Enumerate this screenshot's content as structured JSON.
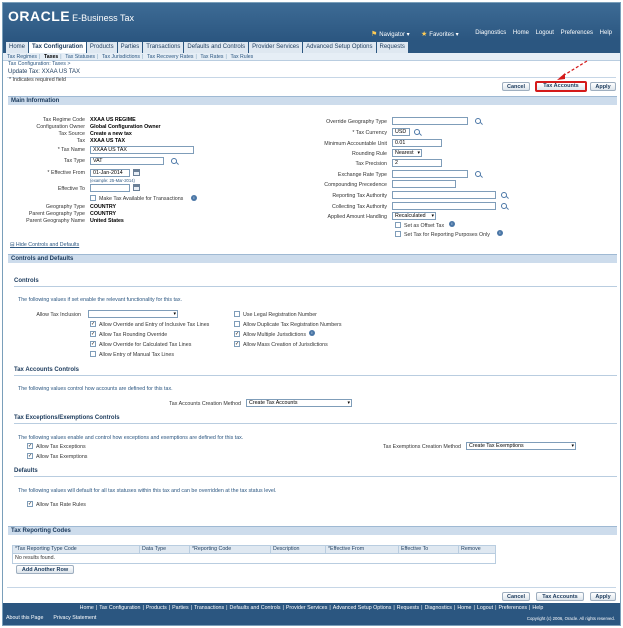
{
  "header": {
    "logo": "ORACLE",
    "product": "E-Business Tax",
    "navigator": "Navigator",
    "favorites": "Favorites",
    "global_links": [
      "Diagnostics",
      "Home",
      "Logout",
      "Preferences",
      "Help"
    ]
  },
  "tabs": [
    "Home",
    "Tax Configuration",
    "Products",
    "Parties",
    "Transactions",
    "Defaults and Controls",
    "Provider Services",
    "Advanced Setup Options",
    "Requests"
  ],
  "subtabs": [
    "Tax Regimes",
    "Taxes",
    "Tax Statuses",
    "Tax Jurisdictions",
    "Tax Recovery Rates",
    "Tax Rates",
    "Tax Rules"
  ],
  "page": {
    "breadcrumb": "Tax Configuration: Taxes >",
    "title": "Update Tax: XXAA US TAX",
    "required_note": "* Indicates required field",
    "buttons": {
      "cancel": "Cancel",
      "tax_accounts": "Tax Accounts",
      "apply": "Apply"
    }
  },
  "main_info": {
    "heading": "Main Information",
    "left": {
      "tax_regime_code_label": "Tax Regime Code",
      "tax_regime_code": "XXAA US REGIME",
      "config_owner_label": "Configuration Owner",
      "config_owner": "Global Configuration Owner",
      "tax_source_label": "Tax Source",
      "tax_source": "Create a new tax",
      "tax_label": "Tax",
      "tax": "XXAA US TAX",
      "tax_name_label": "* Tax Name",
      "tax_name": "XXAA US TAX",
      "tax_type_label": "Tax Type",
      "tax_type": "VAT",
      "effective_from_label": "* Effective From",
      "effective_from": "01-Jan-2014",
      "effective_from_hint": "(example: 25-Mar-2014)",
      "effective_to_label": "Effective To",
      "make_available_label": "Make Tax Available for Transactions",
      "geography_type_label": "Geography Type",
      "geography_type": "COUNTRY",
      "parent_geo_type_label": "Parent Geography Type",
      "parent_geo_type": "COUNTRY",
      "parent_geo_name_label": "Parent Geography Name",
      "parent_geo_name": "United States"
    },
    "right": {
      "override_geo_type_label": "Override Geography Type",
      "tax_currency_label": "* Tax Currency",
      "tax_currency": "USD",
      "min_acct_unit_label": "Minimum Accountable Unit",
      "min_acct_unit": "0.01",
      "rounding_rule_label": "Rounding Rule",
      "rounding_rule": "Nearest",
      "tax_precision_label": "Tax Precision",
      "tax_precision": "2",
      "exchange_rate_type_label": "Exchange Rate Type",
      "compounding_precedence_label": "Compounding Precedence",
      "reporting_tax_authority_label": "Reporting Tax Authority",
      "collecting_tax_authority_label": "Collecting Tax Authority",
      "applied_amount_handling_label": "Applied Amount Handling",
      "applied_amount_handling": "Recalculated",
      "set_offset_tax_label": "Set as Offset Tax",
      "set_reporting_only_label": "Set Tax for Reporting Purposes Only"
    }
  },
  "hide_controls_link": "Hide Controls and Defaults",
  "controls_section": {
    "heading": "Controls and Defaults",
    "controls": {
      "heading": "Controls",
      "info": "The following values if set enable the relevant functionality for this tax.",
      "allow_tax_inclusion_label": "Allow Tax Inclusion",
      "left_checks": [
        {
          "label": "Allow Override and Entry of Inclusive Tax Lines",
          "checked": "true"
        },
        {
          "label": "Allow Tax Rounding Override",
          "checked": "true"
        },
        {
          "label": "Allow Override for Calculated Tax Lines",
          "checked": "true"
        },
        {
          "label": "Allow Entry of Manual Tax Lines",
          "checked": "false"
        }
      ],
      "right_checks": [
        {
          "label": "Use Legal Registration Number",
          "checked": "false"
        },
        {
          "label": "Allow Duplicate Tax Registration Numbers",
          "checked": "false"
        },
        {
          "label": "Allow Multiple Jurisdictions",
          "checked": "true"
        },
        {
          "label": "Allow Mass Creation of Jurisdictions",
          "checked": "true"
        }
      ]
    },
    "accounts": {
      "heading": "Tax Accounts Controls",
      "info": "The following values control how accounts are defined for this tax.",
      "method_label": "Tax Accounts Creation Method",
      "method": "Create Tax Accounts"
    },
    "exemptions": {
      "heading": "Tax Exceptions/Exemptions Controls",
      "info": "The following values enable and control how exceptions and exemptions are defined for this tax.",
      "allow_exceptions": "Allow Tax Exceptions",
      "allow_exemptions": "Allow Tax Exemptions",
      "method_label": "Tax Exemptions Creation Method",
      "method": "Create Tax Exemptions"
    },
    "defaults": {
      "heading": "Defaults",
      "info": "The following values will default for all tax statuses within this tax and can be overridden at the tax status level.",
      "allow_rate_rules": "Allow Tax Rate Rules"
    }
  },
  "reporting_codes": {
    "heading": "Tax Reporting Codes",
    "columns": [
      "*Tax Reporting Type Code",
      "Data Type",
      "*Reporting Code",
      "Description",
      "*Effective From",
      "Effective To",
      "Remove"
    ],
    "empty_text": "No results found.",
    "add_button": "Add Another Row"
  },
  "footer": {
    "links": [
      "Home",
      "Tax Configuration",
      "Products",
      "Parties",
      "Transactions",
      "Defaults and Controls",
      "Provider Services",
      "Advanced Setup Options",
      "Requests",
      "Diagnostics",
      "Home",
      "Logout",
      "Preferences",
      "Help"
    ],
    "about": "About this Page",
    "privacy": "Privacy Statement",
    "copyright": "Copyright (c) 2006, Oracle. All rights reserved."
  }
}
